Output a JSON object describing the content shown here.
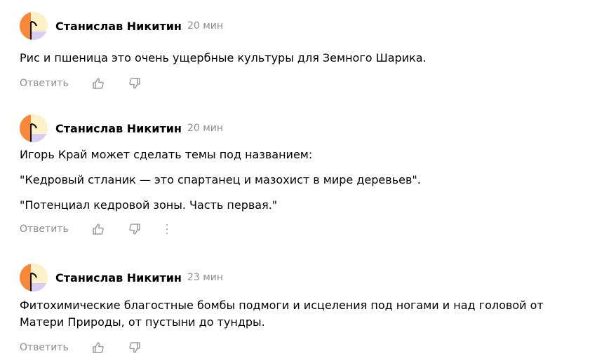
{
  "comments": [
    {
      "author": "Станислав Никитин",
      "time": "20 мин",
      "paragraphs": [
        "Рис и пшеница это очень ущербные культуры для Земного Шарика."
      ],
      "reply_label": "Ответить",
      "has_more_menu": false
    },
    {
      "author": "Станислав Никитин",
      "time": "20 мин",
      "paragraphs": [
        "Игорь Край может сделать темы под названием:",
        "\"Кедровый стланик — это спартанец и мазохист в мире деревьев\".",
        "\"Потенциал кедровой зоны. Часть первая.\""
      ],
      "reply_label": "Ответить",
      "has_more_menu": true
    },
    {
      "author": "Станислав Никитин",
      "time": "23 мин",
      "paragraphs": [
        "Фитохимические благостные бомбы подмоги и исцеления под ногами и над головой от Матери Природы, от пустыни до тундры."
      ],
      "reply_label": "Ответить",
      "has_more_menu": false
    }
  ],
  "icons": {
    "avatar": "avatar-icon",
    "like": "thumbs-up-icon",
    "dislike": "thumbs-down-icon",
    "more": "more-vertical-icon"
  },
  "colors": {
    "avatar_orange": "#f7883a",
    "avatar_cream": "#fdf1c8",
    "avatar_lavender": "#d9cdf3",
    "avatar_dark": "#111111",
    "muted_text": "#8c8c8c",
    "icon_gray": "#9a9a9a"
  }
}
